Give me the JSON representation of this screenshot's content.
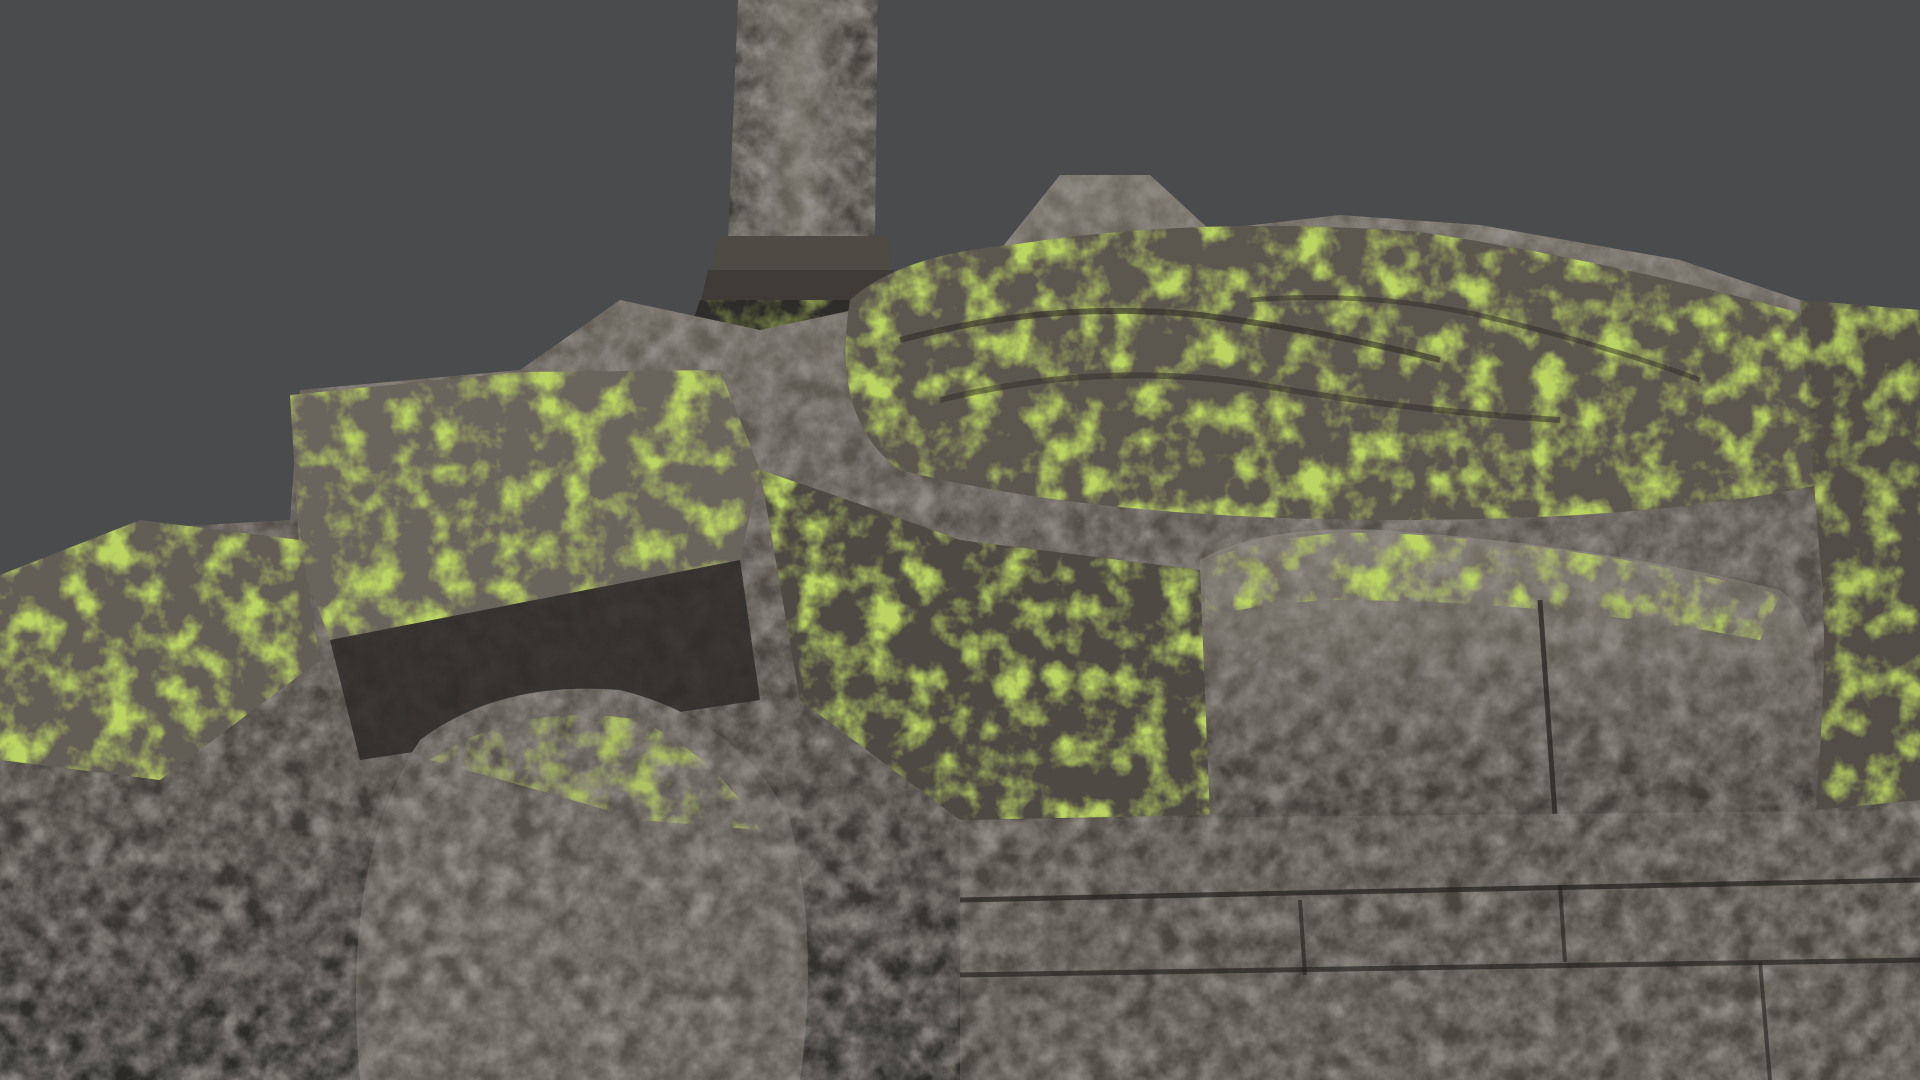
{
  "scene": {
    "subject": "moss-covered-rock-ruin-with-column",
    "background_color": "#4a4b4c",
    "colors": {
      "rock_dark": "#2a2926",
      "rock_mid": "#5a5650",
      "rock_light": "#8e887e",
      "moss_dark": "#4f6a12",
      "moss_mid": "#7fa81e",
      "moss_light": "#a7c63a"
    }
  }
}
